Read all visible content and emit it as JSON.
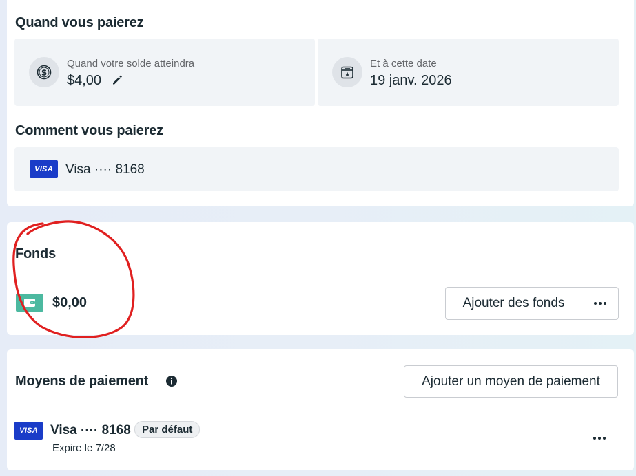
{
  "when_you_pay": {
    "title": "Quand vous paierez",
    "threshold_label": "Quand votre solde atteindra",
    "threshold_value": "$4,00",
    "date_label": "Et à cette date",
    "date_value": "19 janv. 2026",
    "icons": [
      "dollar-coin-icon",
      "pencil-icon",
      "calendar-star-icon"
    ]
  },
  "how_you_pay": {
    "title": "Comment vous paierez",
    "card_brand": "VISA",
    "card_text": "Visa ···· 8168"
  },
  "funds": {
    "title": "Fonds",
    "amount": "$0,00",
    "add_funds_label": "Ajouter des fonds",
    "icons": [
      "wallet-icon",
      "more-icon"
    ],
    "wallet_color": "#4cb9a0"
  },
  "payment_methods": {
    "title": "Moyens de paiement",
    "add_method_label": "Ajouter un moyen de paiement",
    "items": [
      {
        "brand": "VISA",
        "name": "Visa ···· 8168",
        "badge": "Par défaut",
        "expiry": "Expire le 7/28"
      }
    ],
    "icons": [
      "info-icon",
      "more-icon"
    ]
  },
  "colors": {
    "visa_blue": "#1a3cc8",
    "annotation_red": "#e02020"
  }
}
